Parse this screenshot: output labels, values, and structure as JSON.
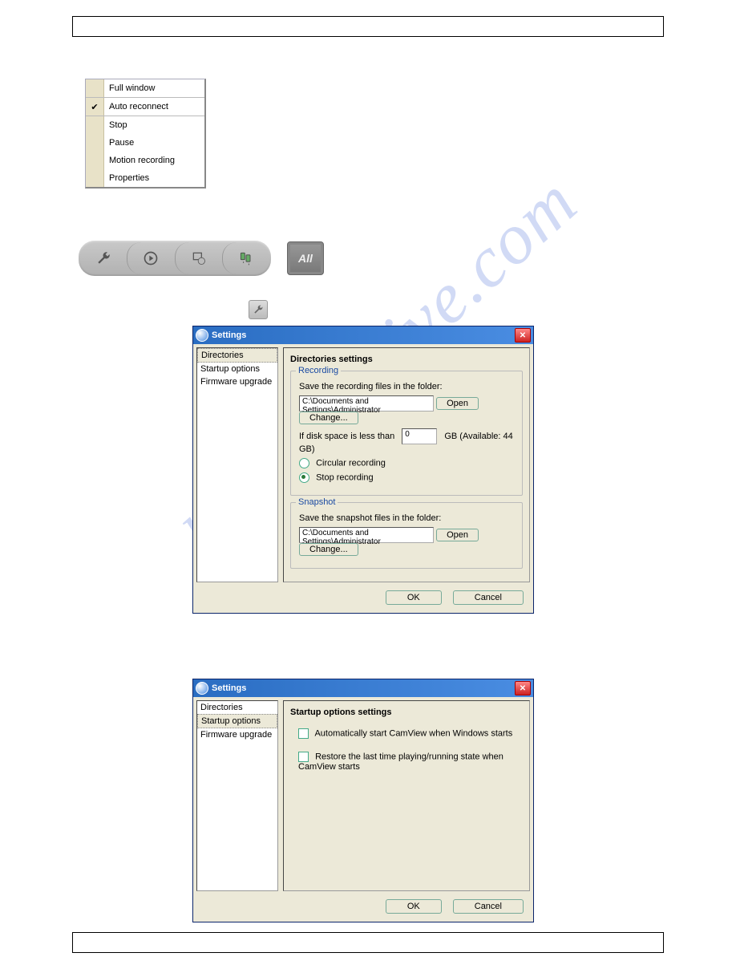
{
  "watermark": "manualslive.com",
  "context_menu": {
    "items": [
      {
        "label": "Full window",
        "checked": false
      },
      {
        "label": "Auto reconnect",
        "checked": true
      },
      {
        "label": "Stop",
        "checked": false
      },
      {
        "label": "Pause",
        "checked": false
      },
      {
        "label": "Motion recording",
        "checked": false
      },
      {
        "label": "Properties",
        "checked": false
      }
    ]
  },
  "toolbar": {
    "all_label": "All"
  },
  "dialog1": {
    "title": "Settings",
    "nav": [
      "Directories",
      "Startup options",
      "Firmware upgrade"
    ],
    "selected_nav": "Directories",
    "panel_title": "Directories settings",
    "recording": {
      "legend": "Recording",
      "save_label": "Save the recording files in the folder:",
      "path": "C:\\Documents and Settings\\Administrator",
      "open": "Open",
      "change": "Change...",
      "disk_label_pre": "If disk space is less than",
      "disk_value": "0",
      "disk_label_post": "GB (Available: 44 GB)",
      "opt_circular": "Circular recording",
      "opt_stop": "Stop recording"
    },
    "snapshot": {
      "legend": "Snapshot",
      "save_label": "Save the snapshot files in the folder:",
      "path": "C:\\Documents and Settings\\Administrator",
      "open": "Open",
      "change": "Change..."
    },
    "ok": "OK",
    "cancel": "Cancel"
  },
  "dialog2": {
    "title": "Settings",
    "nav": [
      "Directories",
      "Startup options",
      "Firmware upgrade"
    ],
    "selected_nav": "Startup options",
    "panel_title": "Startup options settings",
    "opt1": "Automatically start CamView when Windows starts",
    "opt2": "Restore the last time playing/running state when CamView starts",
    "ok": "OK",
    "cancel": "Cancel"
  }
}
